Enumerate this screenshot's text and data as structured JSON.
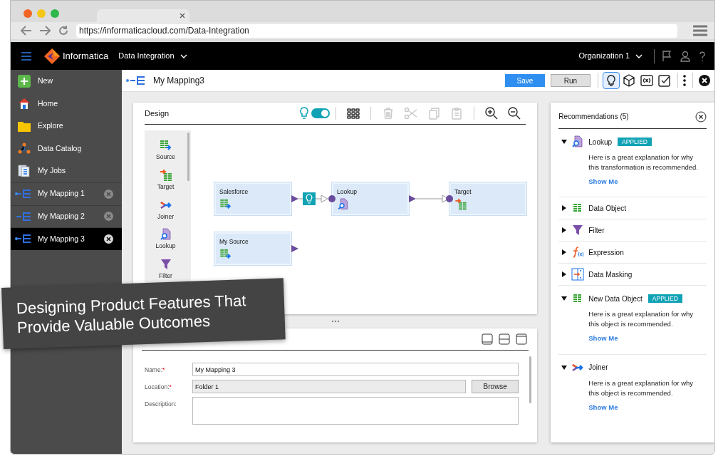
{
  "browser": {
    "url": "https://informaticacloud.com/Data-Integration"
  },
  "app_header": {
    "brand": "Informatica",
    "product": "Data Integration",
    "organization": "Organization 1"
  },
  "sidebar": {
    "items": [
      {
        "label": "New",
        "kind": "nav",
        "unsaved": false,
        "selected": false
      },
      {
        "label": "Home",
        "kind": "nav",
        "unsaved": false,
        "selected": false
      },
      {
        "label": "Explore",
        "kind": "nav",
        "unsaved": false,
        "selected": false
      },
      {
        "label": "Data Catalog",
        "kind": "nav",
        "unsaved": false,
        "selected": false
      },
      {
        "label": "My Jobs",
        "kind": "nav",
        "unsaved": false,
        "selected": false
      },
      {
        "label": "My Mapping 1",
        "kind": "mapping",
        "unsaved": true,
        "selected": false
      },
      {
        "label": "My Mapping 2",
        "kind": "mapping",
        "unsaved": false,
        "selected": false
      },
      {
        "label": "My Mapping 3",
        "kind": "mapping",
        "unsaved": true,
        "selected": true
      }
    ]
  },
  "toolbar": {
    "title": "My Mapping3",
    "unsaved": true,
    "buttons": [
      {
        "label": "Save",
        "kind": "primary"
      },
      {
        "label": "Run",
        "kind": "secondary"
      }
    ],
    "panel_toggles": [
      {
        "selected": true
      },
      {
        "selected": false
      },
      {
        "selected": false
      },
      {
        "selected": false
      }
    ]
  },
  "design": {
    "title": "Design",
    "recommendations_toggle": {
      "on": true
    },
    "tools": [
      {
        "kind": "grid",
        "disabled": false
      },
      {
        "kind": "delete",
        "disabled": true
      },
      {
        "kind": "cut",
        "disabled": true
      },
      {
        "kind": "copy",
        "disabled": true
      },
      {
        "kind": "paste",
        "disabled": true
      },
      {
        "kind": "zoom_in",
        "disabled": false
      },
      {
        "kind": "zoom_out",
        "disabled": false
      }
    ],
    "palette": [
      {
        "label": "Source",
        "kind": "source"
      },
      {
        "label": "Target",
        "kind": "target"
      },
      {
        "label": "Joiner",
        "kind": "joiner"
      },
      {
        "label": "Lookup",
        "kind": "lookup"
      },
      {
        "label": "Filter",
        "kind": "filter"
      }
    ],
    "nodes": [
      {
        "label": "Salesforce",
        "kind": "source"
      },
      {
        "label": "Lookup",
        "kind": "lookup"
      },
      {
        "label": "Target",
        "kind": "target"
      },
      {
        "label": "My Source",
        "kind": "source"
      }
    ]
  },
  "properties": {
    "fields": [
      {
        "label": "Name:",
        "required_mark": "*",
        "value": "My Mapping 3",
        "kind": "text",
        "readonly": false
      },
      {
        "label": "Location:",
        "required_mark": "*",
        "value": "Folder 1",
        "kind": "text",
        "readonly": true,
        "button": "Browse"
      },
      {
        "label": "Description:",
        "kind": "textarea"
      }
    ]
  },
  "recommendations": {
    "title": "Recommendations (5)",
    "items": [
      {
        "name": "Lookup",
        "kind": "lookup",
        "expanded": true,
        "badge": "APPLIED",
        "explanation": "Here is a great explanation for why this transformation is recommended.",
        "link": "Show Me"
      },
      {
        "name": "Data Object",
        "kind": "data_object",
        "expanded": false
      },
      {
        "name": "Filter",
        "kind": "filter",
        "expanded": false
      },
      {
        "name": "Expression",
        "kind": "expression",
        "expanded": false
      },
      {
        "name": "Data Masking",
        "kind": "masking",
        "expanded": false
      },
      {
        "name": "New Data Object",
        "kind": "data_object",
        "expanded": true,
        "badge": "APPLIED",
        "explanation": "Here is a great explanation for why this object is recommended.",
        "link": "Show Me"
      },
      {
        "name": "Joiner",
        "kind": "joiner",
        "expanded": true,
        "explanation": "Here is a great explanation for why this object is recommended.",
        "link": "Show Me"
      }
    ]
  },
  "banner": {
    "lines": [
      "Designing Product Features That",
      "Provide Valuable Outcomes"
    ]
  }
}
